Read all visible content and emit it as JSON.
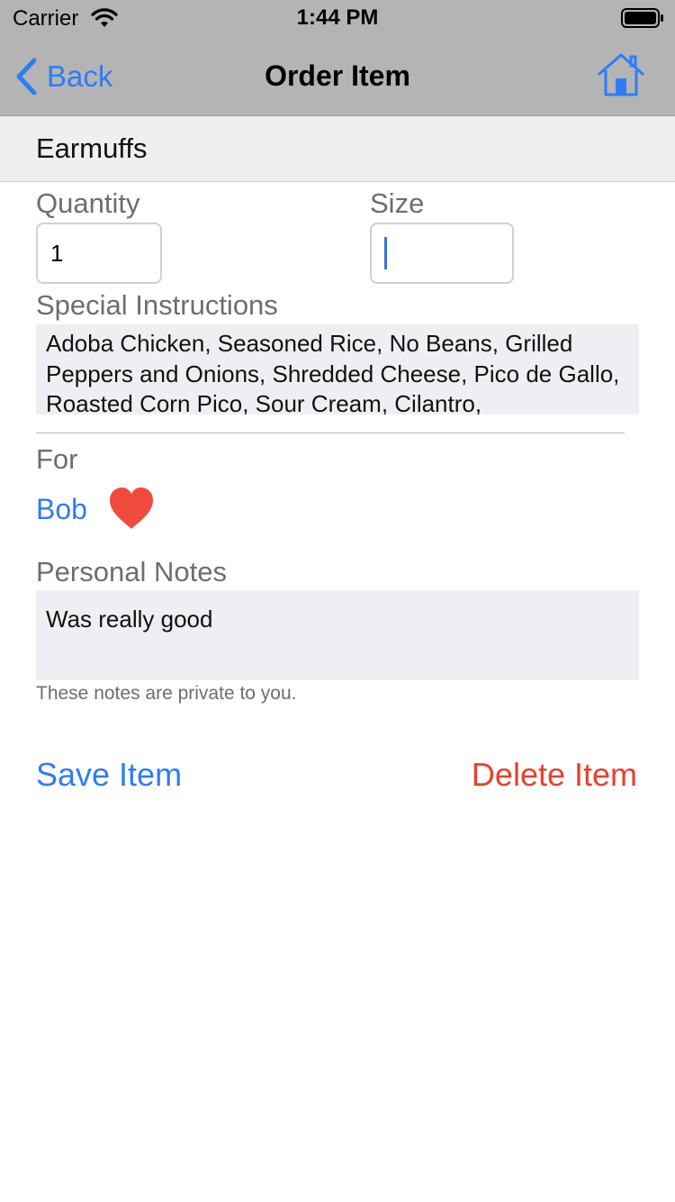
{
  "status_bar": {
    "carrier": "Carrier",
    "time": "1:44 PM"
  },
  "nav": {
    "back_label": "Back",
    "title": "Order Item"
  },
  "item": {
    "name": "Earmuffs"
  },
  "form": {
    "quantity_label": "Quantity",
    "quantity_value": "1",
    "size_label": "Size",
    "size_value": "",
    "special_instructions_label": "Special Instructions",
    "special_instructions_value": "Adoba Chicken, Seasoned Rice, No Beans, Grilled Peppers and Onions, Shredded Cheese, Pico de Gallo, Roasted Corn Pico, Sour Cream, Cilantro,",
    "for_label": "For",
    "for_name": "Bob",
    "personal_notes_label": "Personal Notes",
    "personal_notes_value": "Was really good",
    "personal_notes_hint": "These notes are private to you."
  },
  "actions": {
    "save_label": "Save Item",
    "delete_label": "Delete Item"
  },
  "colors": {
    "accent": "#2f7cf6",
    "destructive": "#e8402f",
    "heart": "#ee4a3e",
    "nav_background": "#b4b4b4"
  },
  "icons": [
    "wifi-icon",
    "battery-icon",
    "chevron-left-icon",
    "home-icon",
    "heart-icon"
  ]
}
